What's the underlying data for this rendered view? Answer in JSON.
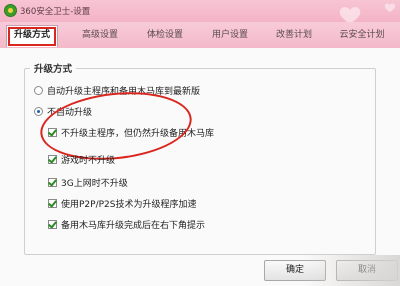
{
  "window": {
    "title": "360安全卫士-设置",
    "app_icon": "app-logo-icon",
    "accent": "#f4b3c6"
  },
  "tabs": [
    {
      "label": "升级方式",
      "active": true
    },
    {
      "label": "高级设置",
      "active": false
    },
    {
      "label": "体检设置",
      "active": false
    },
    {
      "label": "用户设置",
      "active": false
    },
    {
      "label": "改善计划",
      "active": false
    },
    {
      "label": "云安全计划",
      "active": false
    }
  ],
  "group": {
    "title": "升级方式",
    "options": [
      {
        "type": "radio",
        "label": "自动升级主程序和备用木马库到最新版",
        "checked": false
      },
      {
        "type": "radio",
        "label": "不自动升级",
        "checked": true
      },
      {
        "type": "checkbox",
        "label": "不升级主程序，但仍然升级备用木马库",
        "checked": true
      },
      {
        "type": "checkbox",
        "label": "游戏时不升级",
        "checked": true
      },
      {
        "type": "checkbox",
        "label": "3G上网时不升级",
        "checked": true
      },
      {
        "type": "checkbox",
        "label": "使用P2P/P2S技术为升级程序加速",
        "checked": true
      },
      {
        "type": "checkbox",
        "label": "备用木马库升级完成后在右下角提示",
        "checked": true
      }
    ]
  },
  "buttons": {
    "ok": "确定",
    "cancel": "取消"
  },
  "highlight_color": "#d9271f"
}
